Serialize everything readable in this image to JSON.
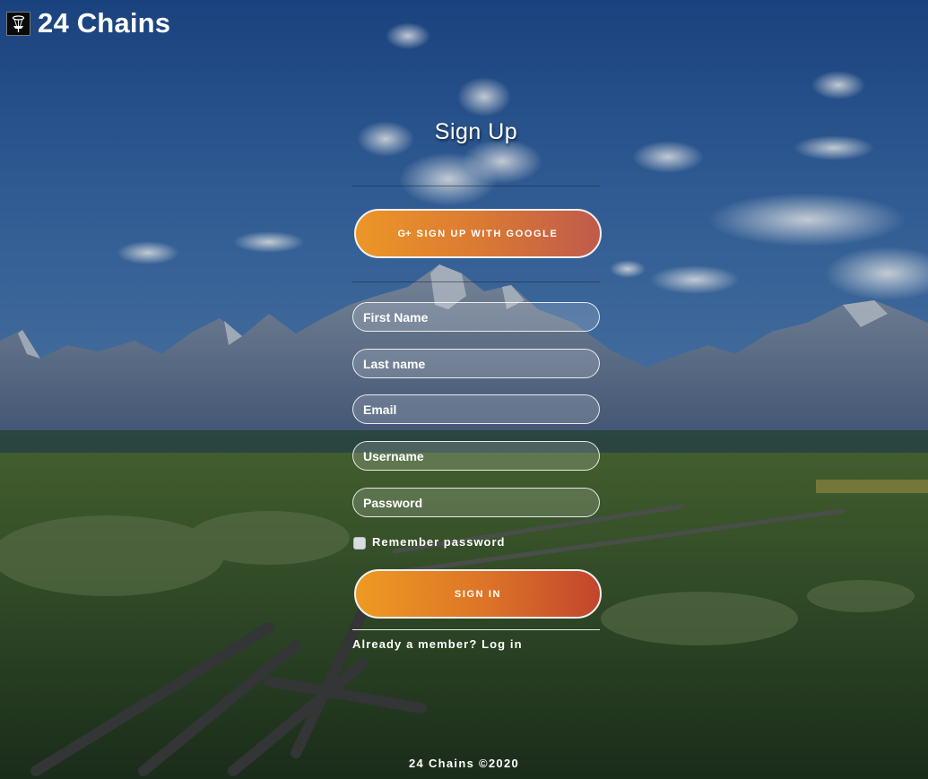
{
  "brand": {
    "name": "24 Chains",
    "logo_icon": "disc-golf-basket-icon"
  },
  "form": {
    "title": "Sign Up",
    "google_button_label": "SIGN UP WITH GOOGLE",
    "google_icon": "google-plus-icon",
    "google_icon_glyph": "G+",
    "fields": [
      {
        "name": "first-name",
        "placeholder": "First Name",
        "value": ""
      },
      {
        "name": "last-name",
        "placeholder": "Last name",
        "value": ""
      },
      {
        "name": "email",
        "placeholder": "Email",
        "value": ""
      },
      {
        "name": "username",
        "placeholder": "Username",
        "value": ""
      },
      {
        "name": "password",
        "placeholder": "Password",
        "value": ""
      }
    ],
    "remember_label": "Remember password",
    "remember_checked": false,
    "signin_button_label": "SIGN IN",
    "login_link": "Already a member? Log in"
  },
  "footer": {
    "text": "24 Chains ©2020"
  },
  "colors": {
    "button_start": "#ec9628",
    "button_end": "#c2452d",
    "sky": "#2a4f86"
  }
}
